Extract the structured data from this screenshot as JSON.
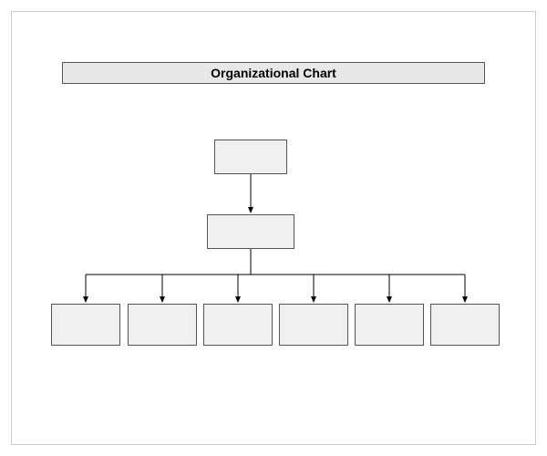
{
  "title": "Organizational Chart",
  "nodes": {
    "top": "",
    "second": "",
    "bottom": [
      "",
      "",
      "",
      "",
      "",
      ""
    ]
  }
}
